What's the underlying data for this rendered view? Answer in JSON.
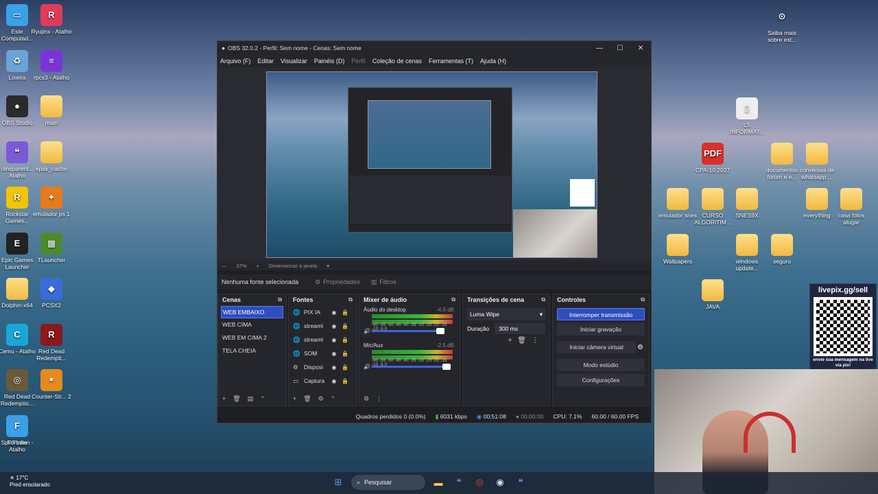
{
  "desktop_icons_left": [
    {
      "label": "Este Computad...",
      "glyph": "▭",
      "color": "#3aa0e8"
    },
    {
      "label": "Ryujinx - Atalho",
      "glyph": "R",
      "color": "#e23a5a"
    },
    {
      "label": "Lixeira",
      "glyph": "♻",
      "color": "#6aa3d8"
    },
    {
      "label": "rpcs3 - Atalho",
      "glyph": "≡",
      "color": "#7a35d8"
    },
    {
      "label": "OBS Studio",
      "glyph": "●",
      "color": "#2b2b2b"
    },
    {
      "label": "main",
      "glyph": "",
      "color": "folder"
    },
    {
      "label": "Transparent... - Atalho",
      "glyph": "❝",
      "color": "#7a5ad8"
    },
    {
      "label": "xpak_cache",
      "glyph": "",
      "color": "folder"
    },
    {
      "label": "Rockstar Games...",
      "glyph": "R",
      "color": "#f2c400"
    },
    {
      "label": "emulador ps 1",
      "glyph": "✦",
      "color": "#e87a1a"
    },
    {
      "label": "Epic Games Launcher",
      "glyph": "E",
      "color": "#222"
    },
    {
      "label": "TLauncher",
      "glyph": "▦",
      "color": "#4d8a2b"
    },
    {
      "label": "Dolphin-x64",
      "glyph": "",
      "color": "folder"
    },
    {
      "label": "PCSX2",
      "glyph": "◆",
      "color": "#3a6bd8"
    },
    {
      "label": "Cemu - Atalho",
      "glyph": "C",
      "color": "#18a7d8"
    },
    {
      "label": "Red Dead Redempti...",
      "glyph": "R",
      "color": "#8a1a1a"
    },
    {
      "label": "Red Dead Redemptio...",
      "glyph": "◎",
      "color": "#6a5a3a"
    },
    {
      "label": "Counter-Str... 2",
      "glyph": "✶",
      "color": "#e88a1a"
    },
    {
      "label": "SplitFiction - Atalho",
      "glyph": "SF",
      "color": "#1a2a4a"
    },
    {
      "label": "Fortnite",
      "glyph": "F",
      "color": "#3aa0e8"
    }
  ],
  "desktop_icons_right": [
    {
      "label": "Saiba mais sobre est...",
      "glyph": "⊙",
      "color": "transparent"
    },
    {
      "label": "LS INFORMAT...",
      "glyph": "▯",
      "color": "#eee"
    },
    {
      "label": "CPA-10 2027",
      "glyph": "PDF",
      "color": "#d8302a"
    },
    {
      "label": "documentos forum e e...",
      "glyph": "",
      "color": "folder"
    },
    {
      "label": "conversas de whatsapp ...",
      "glyph": "",
      "color": "folder"
    },
    {
      "label": "emulador snes",
      "glyph": "",
      "color": "folder"
    },
    {
      "label": "CURSO ALGORITIM...",
      "glyph": "",
      "color": "folder"
    },
    {
      "label": "SNES9X",
      "glyph": "",
      "color": "folder"
    },
    {
      "label": "everything",
      "glyph": "",
      "color": "folder"
    },
    {
      "label": "casa fotos alugar",
      "glyph": "",
      "color": "folder"
    },
    {
      "label": "Wallpapers",
      "glyph": "",
      "color": "folder"
    },
    {
      "label": "windows update...",
      "glyph": "",
      "color": "folder"
    },
    {
      "label": "seguro",
      "glyph": "",
      "color": "folder"
    },
    {
      "label": "JAVA",
      "glyph": "",
      "color": "folder"
    }
  ],
  "obs": {
    "title": "OBS 32.0.2 - Perfil: Sem nome - Cenas: Sem nome",
    "menu": [
      "Arquivo (F)",
      "Editar",
      "Visualizar",
      "Painéis (D)",
      "Perfil",
      "Coleção de cenas",
      "Ferramentas (T)",
      "Ajuda (H)"
    ],
    "zoom": "37%",
    "resize_label": "Dimensionar à janela",
    "no_source": "Nenhuma fonte selecionada",
    "properties": "Propriedades",
    "filters": "Filtros",
    "docks": {
      "scenes_title": "Cenas",
      "sources_title": "Fontes",
      "mixer_title": "Mixer de áudio",
      "transitions_title": "Transições de cena",
      "controls_title": "Controles"
    },
    "scenes": [
      "WEB EMBAIXO",
      "WEB CIMA",
      "WEB EM CIMA 2",
      "TELA CHEIA"
    ],
    "sources": [
      {
        "name": "PIX IA",
        "icon": "🌐"
      },
      {
        "name": "streaml",
        "icon": "🌐"
      },
      {
        "name": "streaml",
        "icon": "🌐"
      },
      {
        "name": "SOM",
        "icon": "🌐"
      },
      {
        "name": "Disposi",
        "icon": "⚙"
      },
      {
        "name": "Captura",
        "icon": "▭"
      }
    ],
    "mixer": [
      {
        "name": "Áudio do desktop",
        "db": "-4.9 dB",
        "level": 0.85
      },
      {
        "name": "Mic/Aux",
        "db": "-2.5 dB",
        "level": 0.92
      }
    ],
    "meter_ticks": "-60 -55 -50 -45 -40 -35 -30 -25 -20 -15 -10 -5 0",
    "transition": "Luma Wipe",
    "duration_label": "Duração",
    "duration_value": "300 ms",
    "controls": {
      "stop_stream": "Interromper transmissão",
      "start_recording": "Iniciar gravação",
      "virtual_cam": "Iniciar câmera virtual",
      "studio_mode": "Modo estúdio",
      "settings": "Configurações"
    },
    "status": {
      "dropped": "Quadros perdidos 0 (0.0%)",
      "bitrate": "6031 kbps",
      "stream_time": "00:51:08",
      "rec_time": "00:00:00",
      "cpu": "CPU: 7.1%",
      "fps": "60.00 / 60.00 FPS"
    }
  },
  "livepix": {
    "url": "livepix.gg/sell",
    "caption": "envie sua mensagem na live via pix!"
  },
  "taskbar": {
    "temp": "17°C",
    "weather": "Pred ensolarado",
    "search": "Pesquisar"
  },
  "colors": {
    "accent": "#2f4ebd"
  }
}
